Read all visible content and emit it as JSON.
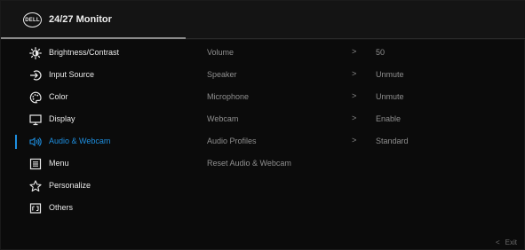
{
  "header": {
    "logo_text": "DELL",
    "title": "24/27 Monitor"
  },
  "menu": {
    "items": [
      {
        "label": "Brightness/Contrast",
        "icon": "brightness-icon"
      },
      {
        "label": "Input Source",
        "icon": "input-source-icon"
      },
      {
        "label": "Color",
        "icon": "color-palette-icon"
      },
      {
        "label": "Display",
        "icon": "display-monitor-icon"
      },
      {
        "label": "Audio & Webcam",
        "icon": "speaker-icon"
      },
      {
        "label": "Menu",
        "icon": "menu-list-icon"
      },
      {
        "label": "Personalize",
        "icon": "star-icon"
      },
      {
        "label": "Others",
        "icon": "others-icon"
      }
    ],
    "active_index": 4,
    "accent_color": "#1e8fe0"
  },
  "submenu": {
    "items": [
      {
        "label": "Volume",
        "arrow": ">",
        "value": "50"
      },
      {
        "label": "Speaker",
        "arrow": ">",
        "value": "Unmute"
      },
      {
        "label": "Microphone",
        "arrow": ">",
        "value": "Unmute"
      },
      {
        "label": "Webcam",
        "arrow": ">",
        "value": "Enable"
      },
      {
        "label": "Audio Profiles",
        "arrow": ">",
        "value": "Standard"
      },
      {
        "label": "Reset Audio & Webcam",
        "arrow": "",
        "value": ""
      }
    ]
  },
  "footer": {
    "exit_chevron": "<",
    "exit_label": "Exit"
  }
}
